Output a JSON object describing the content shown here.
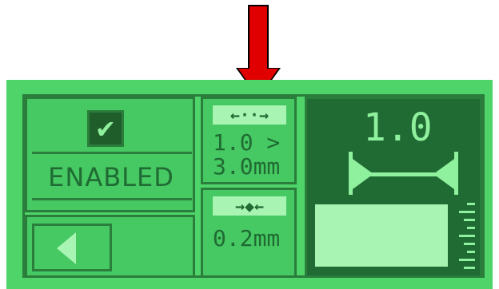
{
  "pointer": {
    "icon": "red-down-arrow"
  },
  "lcd": {
    "enable_panel": {
      "checkbox_icon": "checkmark-icon",
      "checkbox_glyph": "✔",
      "status_label": "ENABLED",
      "checked": true
    },
    "back_panel": {
      "icon": "left-triangle-icon"
    },
    "range_panel": {
      "icon": "outward-dotted-arrows-icon",
      "icon_glyph": "←··→",
      "value_line1": "1.0 >",
      "value_line2": "3.0mm"
    },
    "step_panel": {
      "icon": "inward-arrows-icon",
      "icon_glyph": "→◆←",
      "value": "0.2mm"
    },
    "display_panel": {
      "value": "1.0",
      "icon": "width-dimension-icon",
      "level_fraction": 0.75
    },
    "colors": {
      "lcd_background": "#4fd46a",
      "lcd_dark": "#1f6b33",
      "lcd_light": "#a8f5b3",
      "pointer": "#e00000"
    }
  }
}
